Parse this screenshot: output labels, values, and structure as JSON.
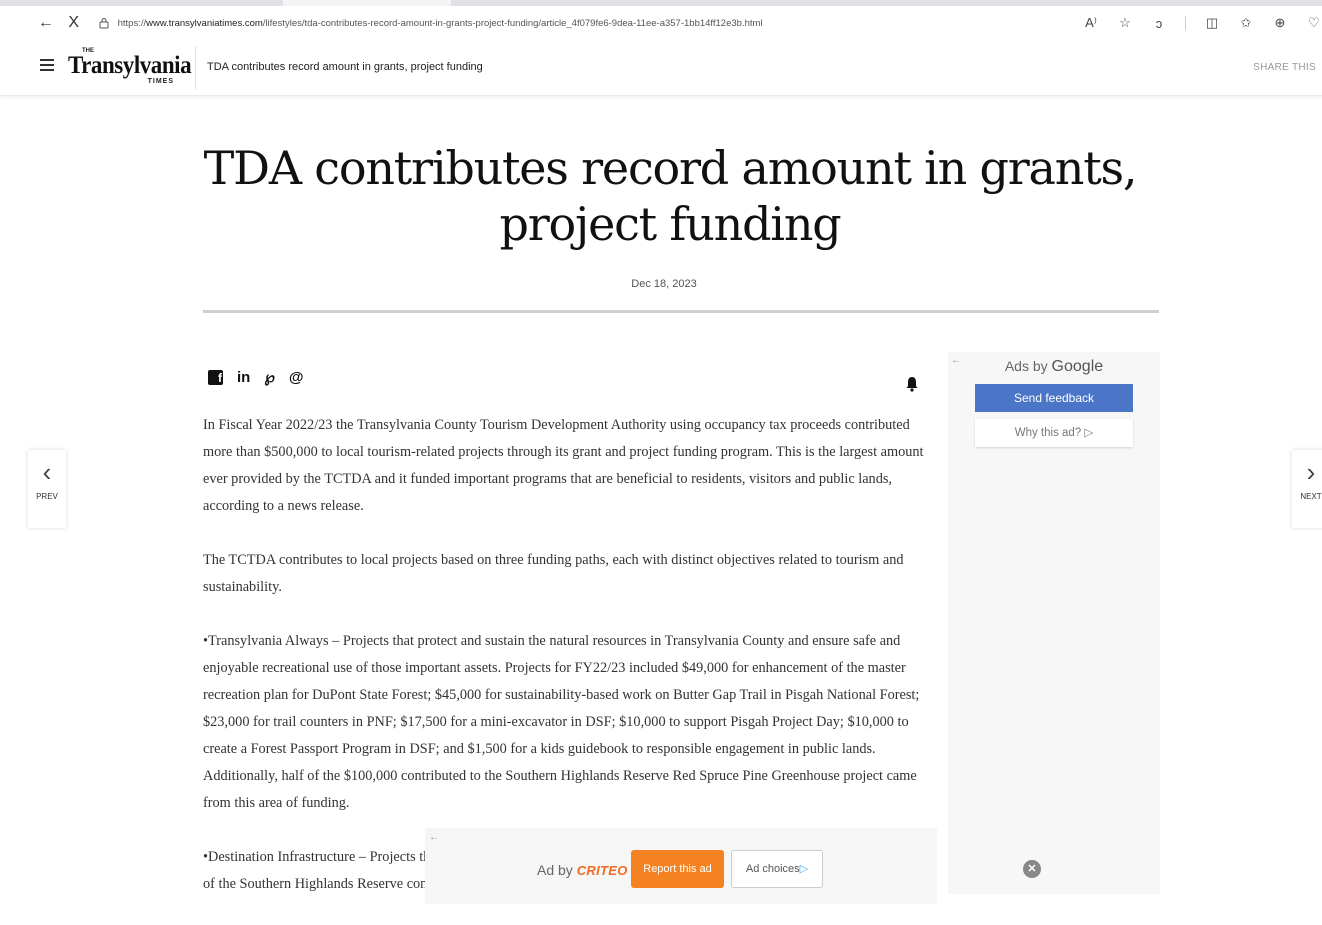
{
  "browser": {
    "url_prefix": "https://",
    "url_domain": "www.transylvaniatimes.com",
    "url_path": "/lifestyles/tda-contributes-record-amount-in-grants-project-funding/article_4f079fe6-9dea-11ee-a357-1bb14ff12e3b.html",
    "back_glyph": "←",
    "stop_glyph": "X",
    "read_aloud_glyph": "A⁾",
    "tool_glyphs": [
      "☆",
      "ↄ",
      "◫",
      "✩",
      "⊕",
      "♡"
    ]
  },
  "header": {
    "logo_the": "THE",
    "logo_main": "Transylvania",
    "logo_times": "TIMES",
    "title": "TDA contributes record amount in grants, project funding",
    "share_label": "SHARE THIS"
  },
  "article": {
    "headline": "TDA contributes record amount in grants, project funding",
    "date": "Dec 18, 2023",
    "share_icons": [
      "f",
      "in",
      "℘",
      "@"
    ],
    "paragraphs": [
      "In Fiscal Year 2022/23 the Transylvania County Tourism Development Authority using occupancy tax proceeds contributed more than $500,000 to local tourism-related projects through its grant and project funding program. This is the largest amount ever provided by the TCTDA and it funded important programs that are beneficial to residents, visitors and public lands, according to a news release.",
      "The TCTDA contributes to local projects based on three funding paths, each with distinct objectives related to tourism and sustainability.",
      "•Transylvania Always – Projects that protect and sustain the natural resources in Transylvania County and ensure safe and enjoyable recreational use of those important assets. Projects for FY22/23 included $49,000 for enhancement of the master recreation plan for DuPont State Forest; $45,000 for sustainability-based work on Butter Gap Trail in Pisgah National Forest; $23,000 for trail counters in PNF; $17,500 for a mini-excavator in DSF; $10,000 to support Pisgah Project Day; $10,000 to create a Forest Passport Program in DSF; and $1,500 for a kids guidebook to responsible engagement in public lands. Additionally, half of the $100,000 contributed to the Southern Highlands Reserve Red Spruce Pine Greenhouse project came from this area of funding.",
      "•Destination Infrastructure – Projects that improve visitor infrastructure in the county. FY22/23 projects included the other half of the Southern Highlands Reserve contribution."
    ]
  },
  "pager": {
    "prev_glyph": "‹",
    "prev_label": "PREV",
    "next_glyph": "›",
    "next_label": "NEXT"
  },
  "google_ad": {
    "back_glyph": "←",
    "ads_by": "Ads by ",
    "google": "Google",
    "send_feedback": "Send feedback",
    "why_this_ad": "Why this ad? ▷",
    "close_glyph": "✕"
  },
  "criteo_ad": {
    "back_glyph": "←",
    "ad_by": "Ad by ",
    "brand": "CRITEO",
    "report": "Report this ad",
    "choices": "Ad choices",
    "choices_glyph": "▷"
  }
}
